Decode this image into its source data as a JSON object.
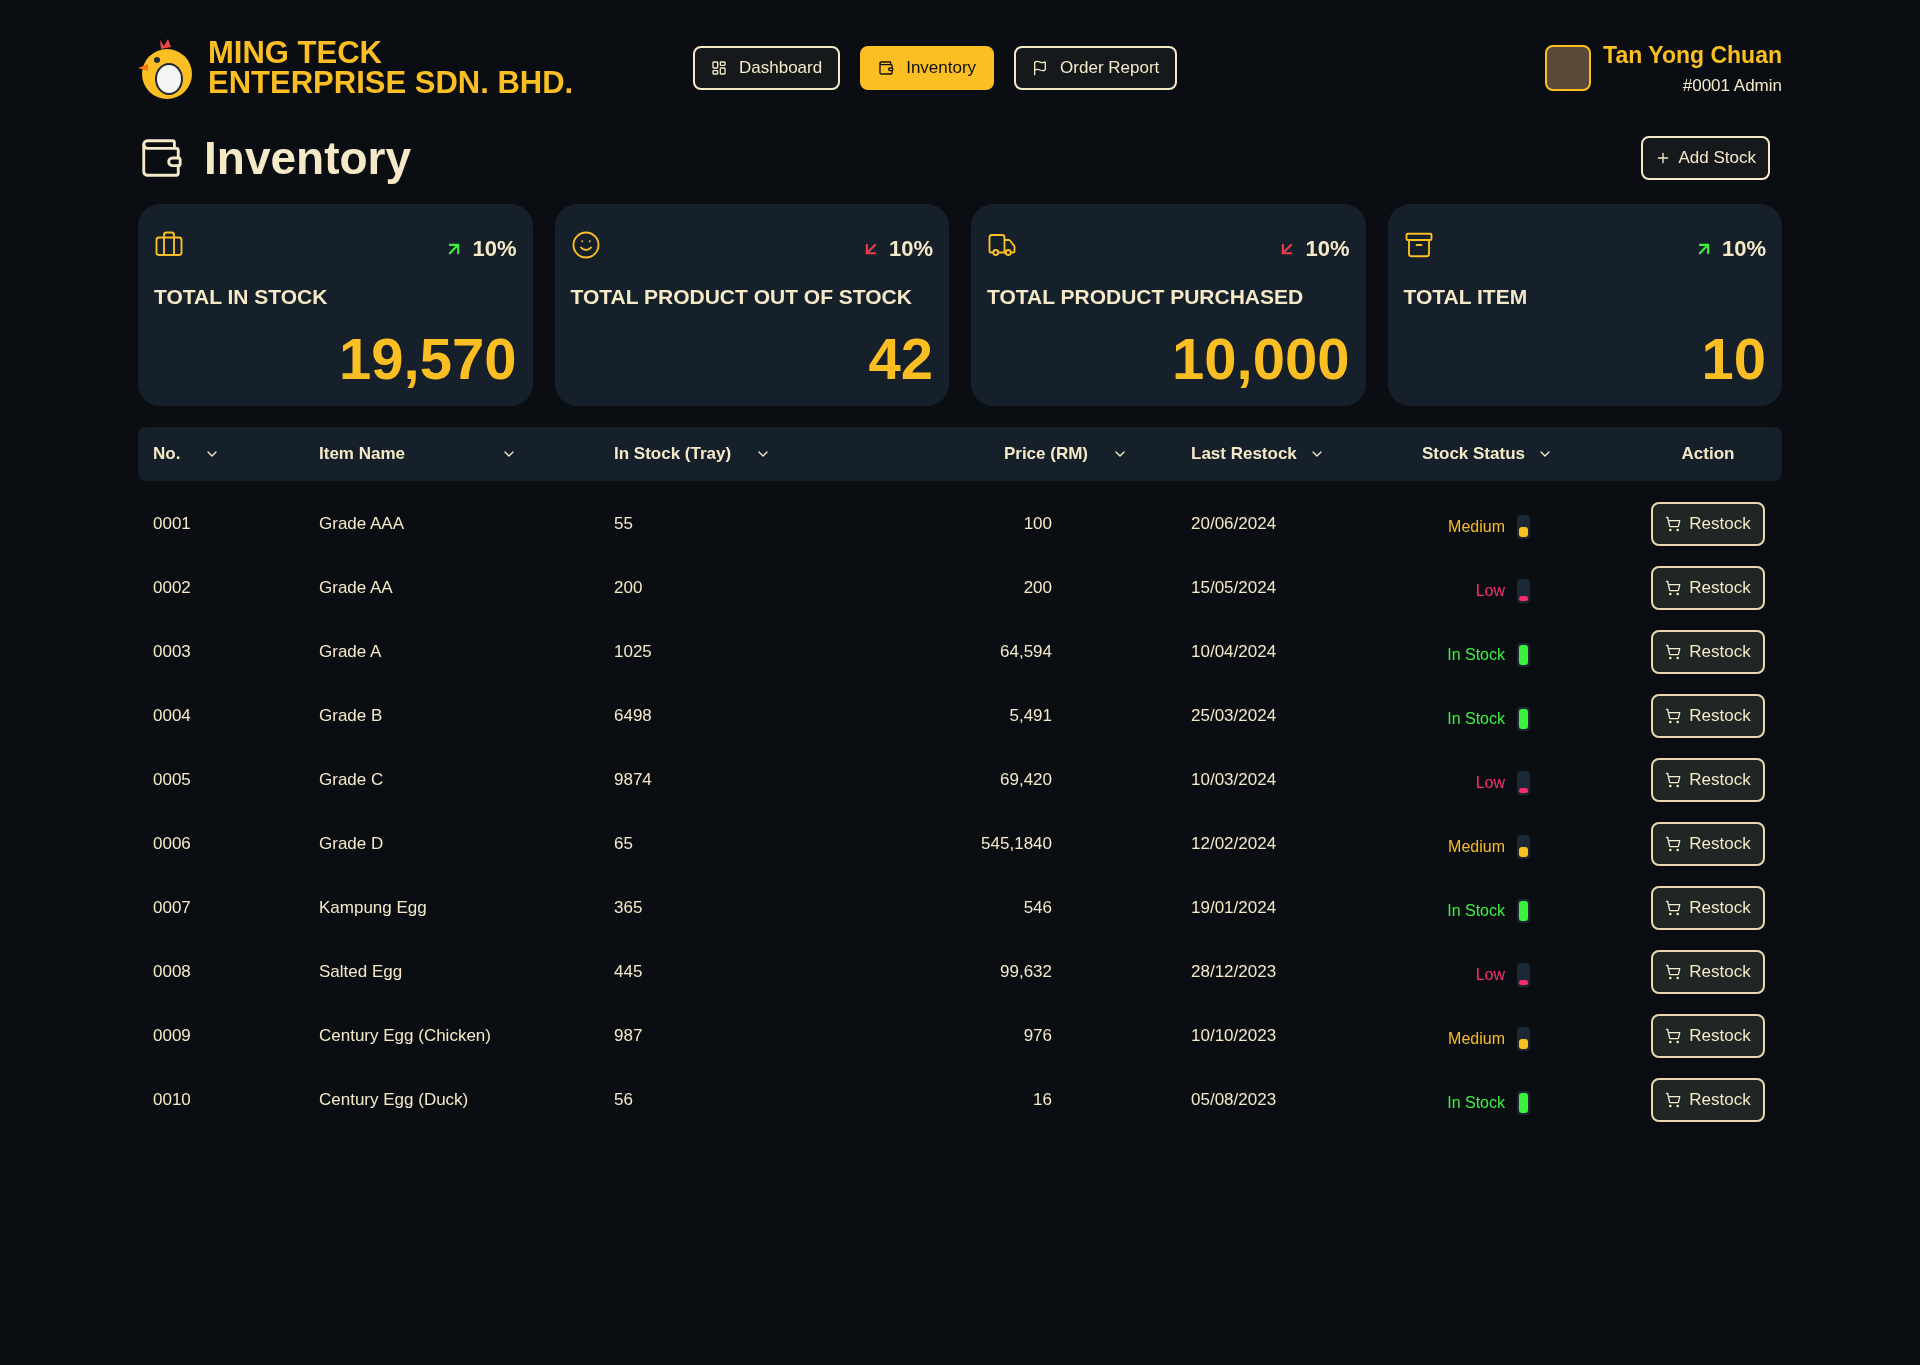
{
  "brand": {
    "line1": "MING TECK",
    "line2": "ENTERPRISE SDN. BHD."
  },
  "nav": [
    {
      "label": "Dashboard",
      "selected": false,
      "kind": "dashboard"
    },
    {
      "label": "Inventory",
      "selected": true,
      "kind": "inventory"
    },
    {
      "label": "Order Report",
      "selected": false,
      "kind": "report"
    }
  ],
  "user": {
    "name": "Tan Yong Chuan",
    "role": "#0001 Admin"
  },
  "page_title": "Inventory",
  "add_button": "Add Stock",
  "cards": [
    {
      "kind": "bag",
      "rising": true,
      "change": "10%",
      "label": "TOTAL IN STOCK",
      "value": "19,570"
    },
    {
      "kind": "smile",
      "rising": false,
      "change": "10%",
      "label": "TOTAL PRODUCT OUT OF STOCK",
      "value": "42"
    },
    {
      "kind": "truck",
      "rising": false,
      "change": "10%",
      "label": "TOTAL PRODUCT PURCHASED",
      "value": "10,000"
    },
    {
      "kind": "box",
      "rising": true,
      "change": "10%",
      "label": "TOTAL ITEM",
      "value": "10"
    }
  ],
  "table": {
    "columns": [
      {
        "label": "No.",
        "sortable": true
      },
      {
        "label": "Item Name",
        "sortable": true
      },
      {
        "label": "In Stock (Tray)",
        "sortable": true
      },
      {
        "label": "Price (RM)",
        "sortable": true
      },
      {
        "label": "Last Restock",
        "sortable": true
      },
      {
        "label": "Stock Status",
        "sortable": true
      },
      {
        "label": "Action",
        "sortable": false
      }
    ],
    "rows": [
      {
        "no": "0001",
        "name": "Grade AAA",
        "stock": "55",
        "price": "100",
        "restock": "20/06/2024",
        "status": "Medium",
        "kind": "medium",
        "level": 0.5,
        "action": "Restock"
      },
      {
        "no": "0002",
        "name": "Grade AA",
        "stock": "200",
        "price": "200",
        "restock": "15/05/2024",
        "status": "Low",
        "kind": "low",
        "level": 0.25,
        "action": "Restock"
      },
      {
        "no": "0003",
        "name": "Grade A",
        "stock": "1025",
        "price": "64,594",
        "restock": "10/04/2024",
        "status": "In Stock",
        "kind": "in_stock",
        "level": 1,
        "action": "Restock"
      },
      {
        "no": "0004",
        "name": "Grade B",
        "stock": "6498",
        "price": "5,491",
        "restock": "25/03/2024",
        "status": "In Stock",
        "kind": "in_stock",
        "level": 1,
        "action": "Restock"
      },
      {
        "no": "0005",
        "name": "Grade C",
        "stock": "9874",
        "price": "69,420",
        "restock": "10/03/2024",
        "status": "Low",
        "kind": "low",
        "level": 0.25,
        "action": "Restock"
      },
      {
        "no": "0006",
        "name": "Grade D",
        "stock": "65",
        "price": "545,1840",
        "restock": "12/02/2024",
        "status": "Medium",
        "kind": "medium",
        "level": 0.5,
        "action": "Restock"
      },
      {
        "no": "0007",
        "name": "Kampung Egg",
        "stock": "365",
        "price": "546",
        "restock": "19/01/2024",
        "status": "In Stock",
        "kind": "in_stock",
        "level": 1,
        "action": "Restock"
      },
      {
        "no": "0008",
        "name": "Salted Egg",
        "stock": "445",
        "price": "99,632",
        "restock": "28/12/2023",
        "status": "Low",
        "kind": "low",
        "level": 0.25,
        "action": "Restock"
      },
      {
        "no": "0009",
        "name": "Century Egg (Chicken)",
        "stock": "987",
        "price": "976",
        "restock": "10/10/2023",
        "status": "Medium",
        "kind": "medium",
        "level": 0.5,
        "action": "Restock"
      },
      {
        "no": "0010",
        "name": "Century Egg (Duck)",
        "stock": "56",
        "price": "16",
        "restock": "05/08/2023",
        "status": "In Stock",
        "kind": "in_stock",
        "level": 1,
        "action": "Restock"
      }
    ]
  }
}
